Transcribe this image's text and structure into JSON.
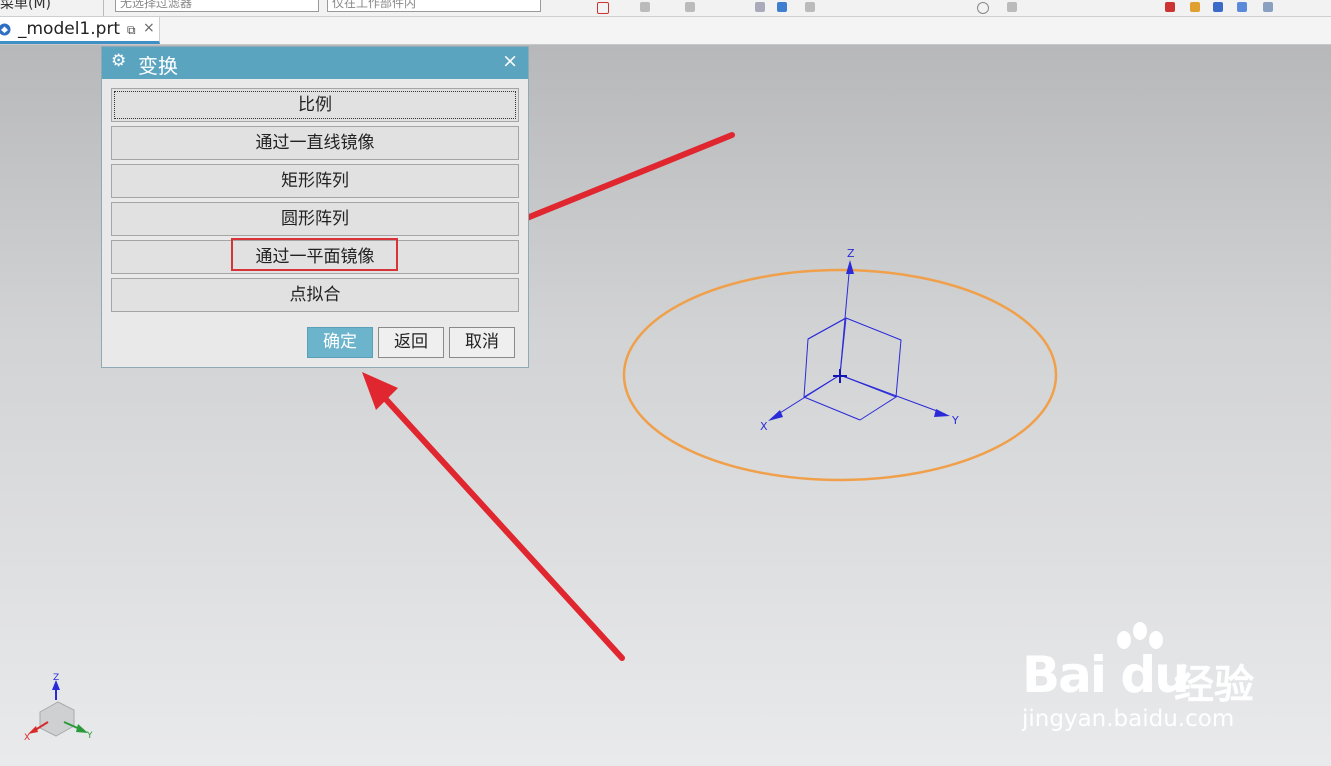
{
  "toolbar": {
    "menu_label": "菜单(M)",
    "filter_placeholder": "无选择过滤器",
    "scope_placeholder": "仅在工作部件内"
  },
  "tab": {
    "label": "_model1.prt",
    "pin_glyph": "⧉",
    "close_glyph": "×"
  },
  "dialog": {
    "title": "变换",
    "gear_glyph": "⚙",
    "close_glyph": "×",
    "options": [
      {
        "label": "比例"
      },
      {
        "label": "通过一直线镜像"
      },
      {
        "label": "矩形阵列"
      },
      {
        "label": "圆形阵列"
      },
      {
        "label": "通过一平面镜像"
      },
      {
        "label": "点拟合"
      }
    ],
    "buttons": {
      "ok": "确定",
      "back": "返回",
      "cancel": "取消"
    }
  },
  "scene": {
    "axis_x": "X",
    "axis_y": "Y",
    "axis_z": "Z",
    "circle_color": "#f0a04b",
    "wcs_color": "#2a2ad8",
    "arrow_color": "#e0262e"
  },
  "watermark": {
    "brand": "Bai  du",
    "suffix": "经验",
    "url": "jingyan.baidu.com"
  }
}
